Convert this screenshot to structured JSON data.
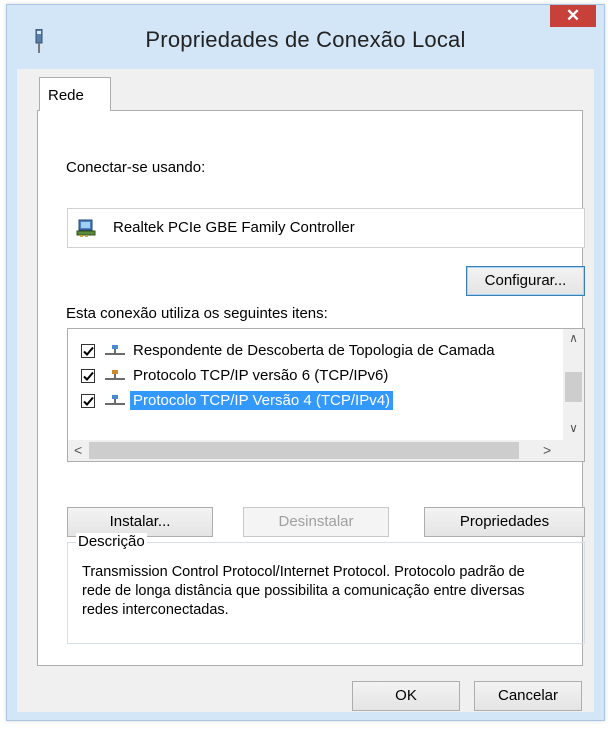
{
  "window": {
    "title": "Propriedades de Conexão Local",
    "close_glyph": "✕"
  },
  "tabs": [
    {
      "label": "Rede",
      "active": true
    }
  ],
  "connect_using": {
    "label": "Conectar-se usando:",
    "adapter_name": "Realtek PCIe GBE Family Controller",
    "adapter_icon": "network-adapter-icon",
    "configure_button": "Configurar..."
  },
  "items_section": {
    "label": "Esta conexão utiliza os seguintes itens:",
    "items": [
      {
        "label": "Respondente de Descoberta de Topologia de Camada",
        "checked": true,
        "selected": false,
        "icon": "protocol-icon"
      },
      {
        "label": "Protocolo TCP/IP versão 6 (TCP/IPv6)",
        "checked": true,
        "selected": false,
        "icon": "protocol-icon"
      },
      {
        "label": "Protocolo TCP/IP Versão 4 (TCP/IPv4)",
        "checked": true,
        "selected": true,
        "icon": "protocol-icon"
      }
    ]
  },
  "action_buttons": {
    "install": "Instalar...",
    "uninstall": "Desinstalar",
    "properties": "Propriedades"
  },
  "description": {
    "title": "Descrição",
    "text": "Transmission Control Protocol/Internet Protocol. Protocolo padrão de rede de longa distância que possibilita a comunicação entre diversas redes interconectadas."
  },
  "footer": {
    "ok": "OK",
    "cancel": "Cancelar"
  },
  "colors": {
    "frame": "#d3e6f8",
    "close": "#c7403a",
    "selection": "#3399ff"
  }
}
